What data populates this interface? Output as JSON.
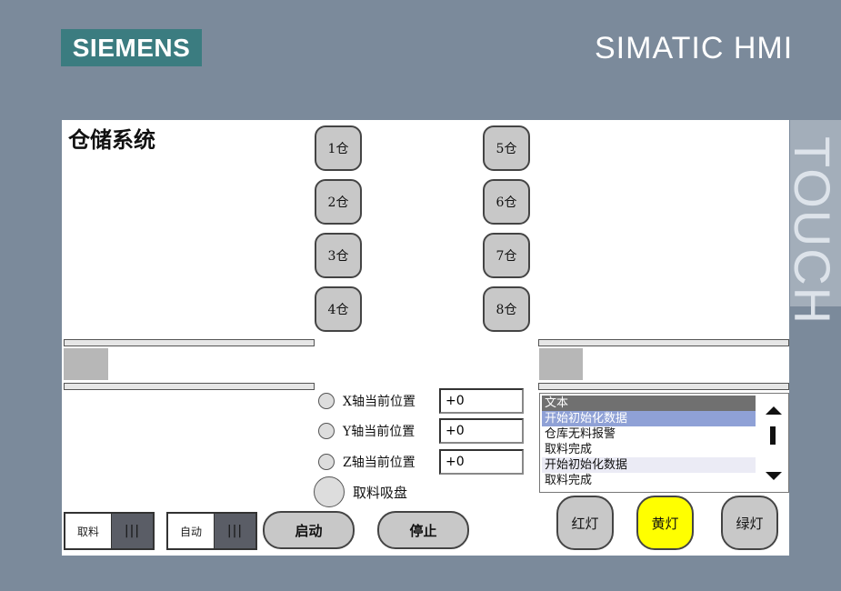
{
  "bezel": {
    "brand": "SIEMENS",
    "product": "SIMATIC HMI",
    "touch_label": "TOUCH"
  },
  "screen": {
    "title": "仓储系统",
    "warehouse_buttons": [
      "1仓",
      "2仓",
      "3仓",
      "4仓",
      "5仓",
      "6仓",
      "7仓",
      "8仓"
    ],
    "axes": [
      {
        "label": "X轴当前位置",
        "value": "+0"
      },
      {
        "label": "Y轴当前位置",
        "value": "+0"
      },
      {
        "label": "Z轴当前位置",
        "value": "+0"
      }
    ],
    "suction_label": "取料吸盘",
    "alarm_list": {
      "header": "文本",
      "rows": [
        "开始初始化数据",
        "仓库无料报警",
        "取料完成",
        "开始初始化数据",
        "取料完成"
      ],
      "selected_index": 0
    },
    "switches": [
      {
        "label": "取料",
        "knob": "|||"
      },
      {
        "label": "自动",
        "knob": "|||"
      }
    ],
    "start_label": "启动",
    "stop_label": "停止",
    "lamps": {
      "red": "红灯",
      "yellow": "黄灯",
      "green": "绿灯",
      "active_color": "#ffff00"
    }
  }
}
